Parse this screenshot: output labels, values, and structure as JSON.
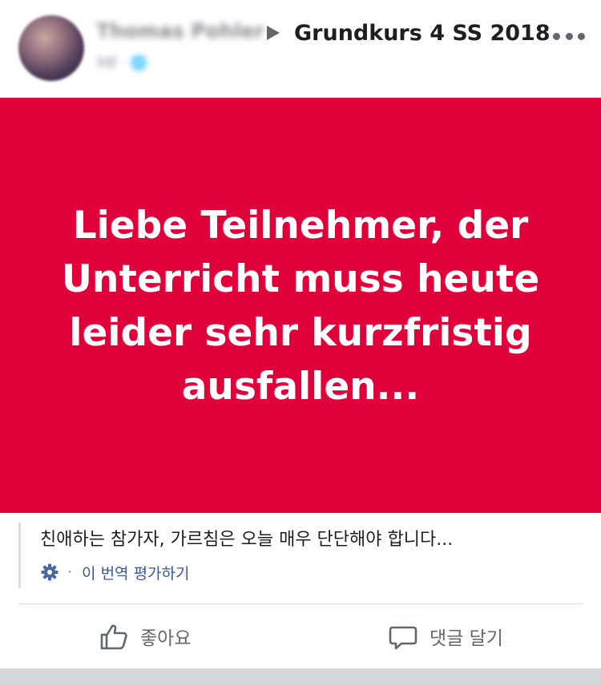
{
  "post": {
    "author_name": "Thomas Pohler",
    "meta": "9분 · 🌐",
    "group_name": "Grundkurs 4 SS 2018",
    "banner_text": "Liebe Teilnehmer, der Unterricht muss heute leider sehr kurzfristig ausfallen...",
    "banner_color": "#e0003a"
  },
  "translation": {
    "text": "친애하는 참가자, 가르침은 오늘 매우 단단해야 합니다...",
    "separator": "·",
    "rate_label": "이 번역 평가하기"
  },
  "actions": {
    "like_label": "좋아요",
    "comment_label": "댓글 달기"
  },
  "icons": {
    "avatar": "profile-photo",
    "arrow": "triangle-right-icon",
    "more": "more-options-icon",
    "gear": "gear-icon",
    "like": "thumbs-up-icon",
    "comment": "comment-bubble-icon"
  },
  "colors": {
    "link": "#385898",
    "text_secondary": "#606770"
  }
}
